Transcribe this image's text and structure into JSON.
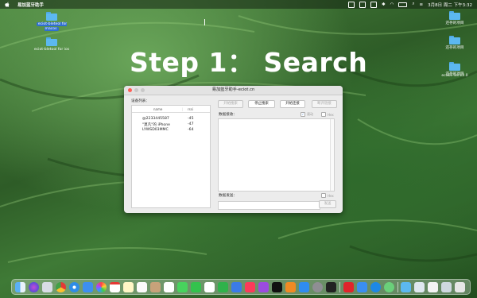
{
  "menubar": {
    "app_name": "易加蓝牙助手",
    "datetime": "3月8日 周二 下午3:32"
  },
  "desktop_left": [
    {
      "label": "eciot-bleteol for macos",
      "selected": true
    },
    {
      "label": "eciot-bletool for ios",
      "selected": false
    }
  ],
  "desktop_right": [
    {
      "label": "还存的项目"
    },
    {
      "label": "还存的项目"
    },
    {
      "label": "还存的项目"
    },
    {
      "label": "ecabs-ios-v2.0"
    }
  ],
  "headline": "Step 1：  Search",
  "window": {
    "title": "易加蓝牙助手-eciot.cn",
    "device_list_label": "设备列表：",
    "col_name": "name",
    "col_rssi": "rssi",
    "devices": [
      {
        "name": "@2233445587",
        "rssi": "-45"
      },
      {
        "name": "\"莫凡\"的 iPhone",
        "rssi": "-47"
      },
      {
        "name": "LYWSD03MMC",
        "rssi": "-64"
      }
    ],
    "btn_start_search": "开始搜索",
    "btn_stop_search": "停止搜索",
    "btn_start_connect": "开始连接",
    "btn_disconnect": "断开链接",
    "recv_label": "数据接收：",
    "recv_opt1": "滚动",
    "recv_opt2": "Hex",
    "send_label": "数据发送：",
    "send_opt": "Hex",
    "btn_send": "发送",
    "send_placeholder": ""
  }
}
